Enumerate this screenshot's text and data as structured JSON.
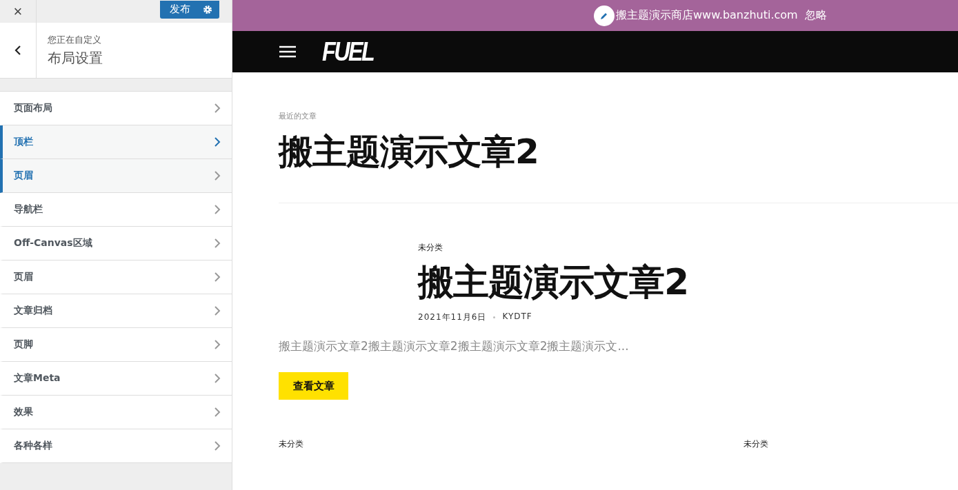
{
  "customizer": {
    "close": "×",
    "publish_button": "发布",
    "breadcrumb": "您正在自定义",
    "section_title": "布局设置",
    "items": [
      {
        "label": "页面布局",
        "selected": false,
        "highlighted": false
      },
      {
        "label": "顶栏",
        "selected": true,
        "highlighted": true
      },
      {
        "label": "页眉",
        "selected": false,
        "highlighted": true
      },
      {
        "label": "导航栏",
        "selected": false,
        "highlighted": false
      },
      {
        "label": "Off-Canvas区域",
        "selected": false,
        "highlighted": false
      },
      {
        "label": "页眉",
        "selected": false,
        "highlighted": false
      },
      {
        "label": "文章归档",
        "selected": false,
        "highlighted": false
      },
      {
        "label": "页脚",
        "selected": false,
        "highlighted": false
      },
      {
        "label": "文章Meta",
        "selected": false,
        "highlighted": false
      },
      {
        "label": "效果",
        "selected": false,
        "highlighted": false
      },
      {
        "label": "各种各样",
        "selected": false,
        "highlighted": false
      }
    ]
  },
  "preview": {
    "store_notice": "搬主题演示商店www.banzhuti.com",
    "dismiss": "忽略",
    "logo": "FUEL",
    "page_label": "最近的文章",
    "page_title": "搬主题演示文章2",
    "post": {
      "category": "未分类",
      "title": "搬主题演示文章2",
      "date": "2021年11月6日",
      "author": "KYDTF",
      "excerpt": "搬主题演示文章2搬主题演示文章2搬主题演示文章2搬主题演示文...",
      "button": "查看文章"
    },
    "next_categories": [
      "未分类",
      "未分类"
    ]
  }
}
